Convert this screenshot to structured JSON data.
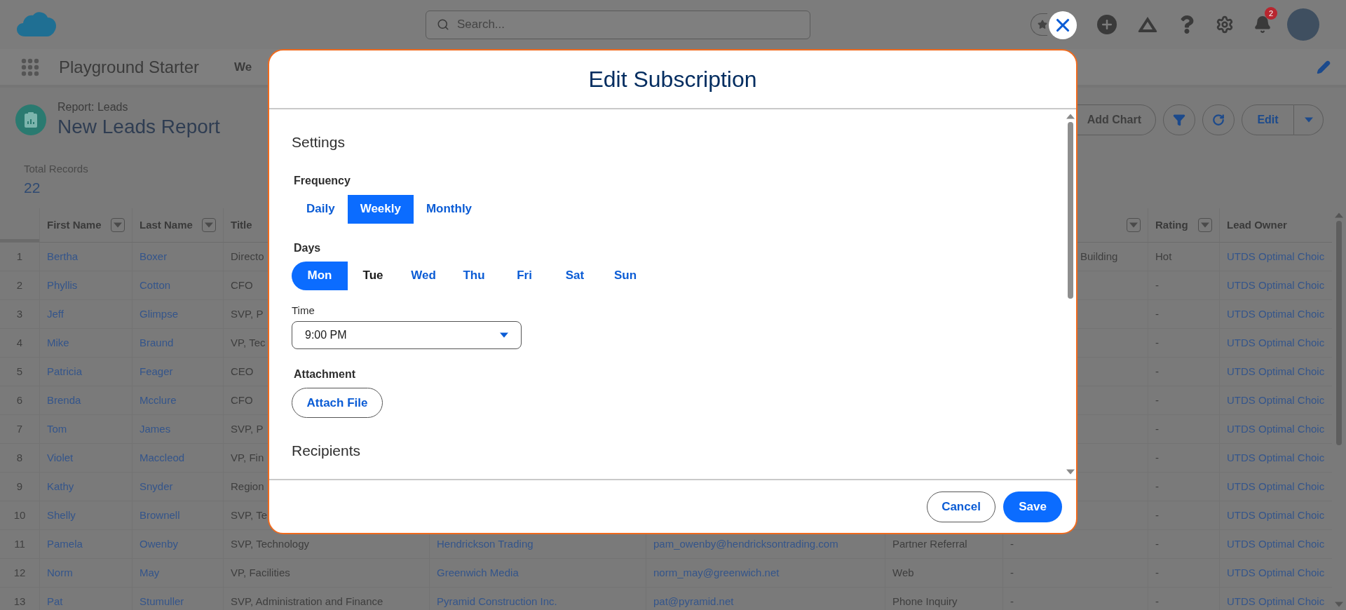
{
  "top_bar": {
    "search": {
      "placeholder": "Search..."
    },
    "notification_count": "2"
  },
  "app_nav": {
    "app_name": "Playground Starter",
    "tab": "We"
  },
  "report_header": {
    "breadcrumb": "Report: Leads",
    "title": "New Leads Report",
    "add_chart": "Add Chart",
    "edit": "Edit"
  },
  "summary": {
    "label": "Total Records",
    "value": "22"
  },
  "table": {
    "columns": [
      {
        "label": "First Name",
        "filter": true,
        "kind": "link"
      },
      {
        "label": "Last Name",
        "filter": true,
        "kind": "link"
      },
      {
        "label": "Title",
        "kind": "text"
      },
      {
        "kind": "link"
      },
      {
        "kind": "link"
      },
      {
        "kind": "text"
      },
      {
        "filter": true,
        "kind": "text"
      },
      {
        "label": "Rating",
        "filter": true,
        "kind": "text"
      },
      {
        "label": "Lead Owner",
        "kind": "link"
      }
    ],
    "rows": [
      {
        "number": "1",
        "cells": [
          "Bertha",
          "Boxer",
          "Directo",
          null,
          null,
          null,
          "Building",
          "Hot",
          "UTDS Optimal Choic"
        ]
      },
      {
        "number": "2",
        "cells": [
          "Phyllis",
          "Cotton",
          "CFO",
          null,
          null,
          null,
          null,
          "-",
          "UTDS Optimal Choic"
        ]
      },
      {
        "number": "3",
        "cells": [
          "Jeff",
          "Glimpse",
          "SVP, P",
          null,
          null,
          null,
          null,
          "-",
          "UTDS Optimal Choic"
        ]
      },
      {
        "number": "4",
        "cells": [
          "Mike",
          "Braund",
          "VP, Tec",
          null,
          null,
          null,
          null,
          "-",
          "UTDS Optimal Choic"
        ]
      },
      {
        "number": "5",
        "cells": [
          "Patricia",
          "Feager",
          "CEO",
          null,
          null,
          null,
          null,
          "-",
          "UTDS Optimal Choic"
        ]
      },
      {
        "number": "6",
        "cells": [
          "Brenda",
          "Mcclure",
          "CFO",
          null,
          null,
          null,
          null,
          "-",
          "UTDS Optimal Choic"
        ]
      },
      {
        "number": "7",
        "cells": [
          "Tom",
          "James",
          "SVP, P",
          null,
          null,
          null,
          null,
          "-",
          "UTDS Optimal Choic"
        ]
      },
      {
        "number": "8",
        "cells": [
          "Violet",
          "Maccleod",
          "VP, Fin",
          null,
          null,
          null,
          null,
          "-",
          "UTDS Optimal Choic"
        ]
      },
      {
        "number": "9",
        "cells": [
          "Kathy",
          "Snyder",
          "Region",
          null,
          null,
          null,
          null,
          "-",
          "UTDS Optimal Choic"
        ]
      },
      {
        "number": "10",
        "cells": [
          "Shelly",
          "Brownell",
          "SVP, Te",
          null,
          null,
          null,
          null,
          "-",
          "UTDS Optimal Choic"
        ]
      },
      {
        "number": "11",
        "cells": [
          "Pamela",
          "Owenby",
          "SVP, Technology",
          "Hendrickson Trading",
          "pam_owenby@hendricksontrading.com",
          "Partner Referral",
          "-",
          "-",
          "UTDS Optimal Choic"
        ]
      },
      {
        "number": "12",
        "cells": [
          "Norm",
          "May",
          "VP, Facilities",
          "Greenwich Media",
          "norm_may@greenwich.net",
          "Web",
          "-",
          "-",
          "UTDS Optimal Choic"
        ]
      },
      {
        "number": "13",
        "cells": [
          "Pat",
          "Stumuller",
          "SVP, Administration and Finance",
          "Pyramid Construction Inc.",
          "pat@pyramid.net",
          "Phone Inquiry",
          "-",
          "-",
          "UTDS Optimal Choic"
        ]
      }
    ]
  },
  "modal": {
    "title": "Edit Subscription",
    "settings_heading": "Settings",
    "frequency": {
      "label": "Frequency",
      "options": [
        {
          "label": "Daily",
          "selected": false
        },
        {
          "label": "Weekly",
          "selected": true
        },
        {
          "label": "Monthly",
          "selected": false
        }
      ]
    },
    "days": {
      "label": "Days",
      "options": [
        {
          "label": "Mon",
          "selected": true,
          "focused": false
        },
        {
          "label": "Tue",
          "selected": false,
          "focused": true
        },
        {
          "label": "Wed",
          "selected": false,
          "focused": false
        },
        {
          "label": "Thu",
          "selected": false,
          "focused": false
        },
        {
          "label": "Fri",
          "selected": false,
          "focused": false
        },
        {
          "label": "Sat",
          "selected": false,
          "focused": false
        },
        {
          "label": "Sun",
          "selected": false,
          "focused": false
        }
      ]
    },
    "time": {
      "label": "Time",
      "value": "9:00 PM"
    },
    "attachment": {
      "label": "Attachment",
      "button": "Attach File"
    },
    "recipients_heading": "Recipients",
    "buttons": [
      {
        "label": "Cancel",
        "kind": "secondary"
      },
      {
        "label": "Save",
        "kind": "primary"
      }
    ]
  }
}
